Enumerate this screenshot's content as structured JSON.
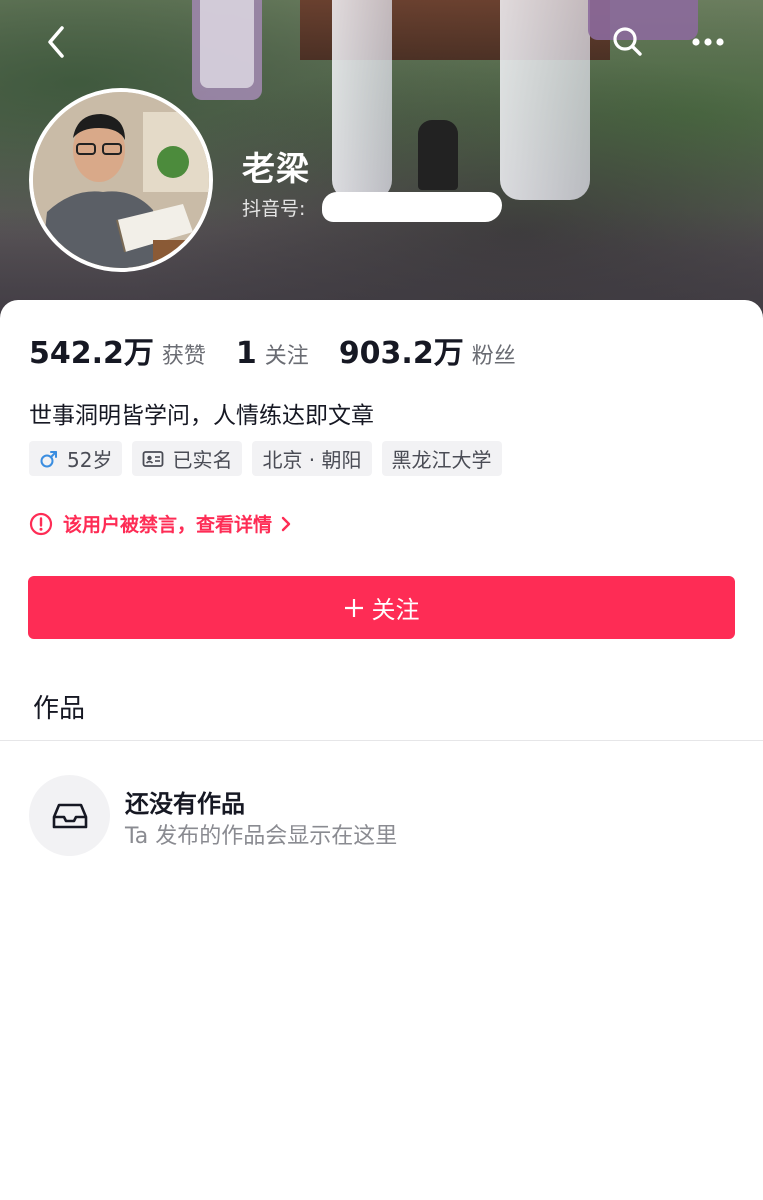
{
  "header": {
    "back_icon": "chevron-left-icon",
    "search_icon": "search-icon",
    "more_icon": "more-horizontal-icon"
  },
  "profile": {
    "name": "老梁",
    "douyin_id_label": "抖音号:"
  },
  "stats": [
    {
      "value": "542.2万",
      "label": "获赞"
    },
    {
      "value": "1",
      "label": "关注"
    },
    {
      "value": "903.2万",
      "label": "粉丝"
    }
  ],
  "bio": "世事洞明皆学问，人情练达即文章",
  "tags": {
    "age": "52岁",
    "verified": "已实名",
    "location": "北京 · 朝阳",
    "school": "黑龙江大学"
  },
  "notice": {
    "text": "该用户被禁言，查看详情"
  },
  "follow_button": {
    "label": "关注"
  },
  "works": {
    "tab_label": "作品",
    "empty_title": "还没有作品",
    "empty_subtitle": "Ta 发布的作品会显示在这里"
  },
  "colors": {
    "accent": "#fe2c55",
    "male_icon": "#3a8de0"
  }
}
